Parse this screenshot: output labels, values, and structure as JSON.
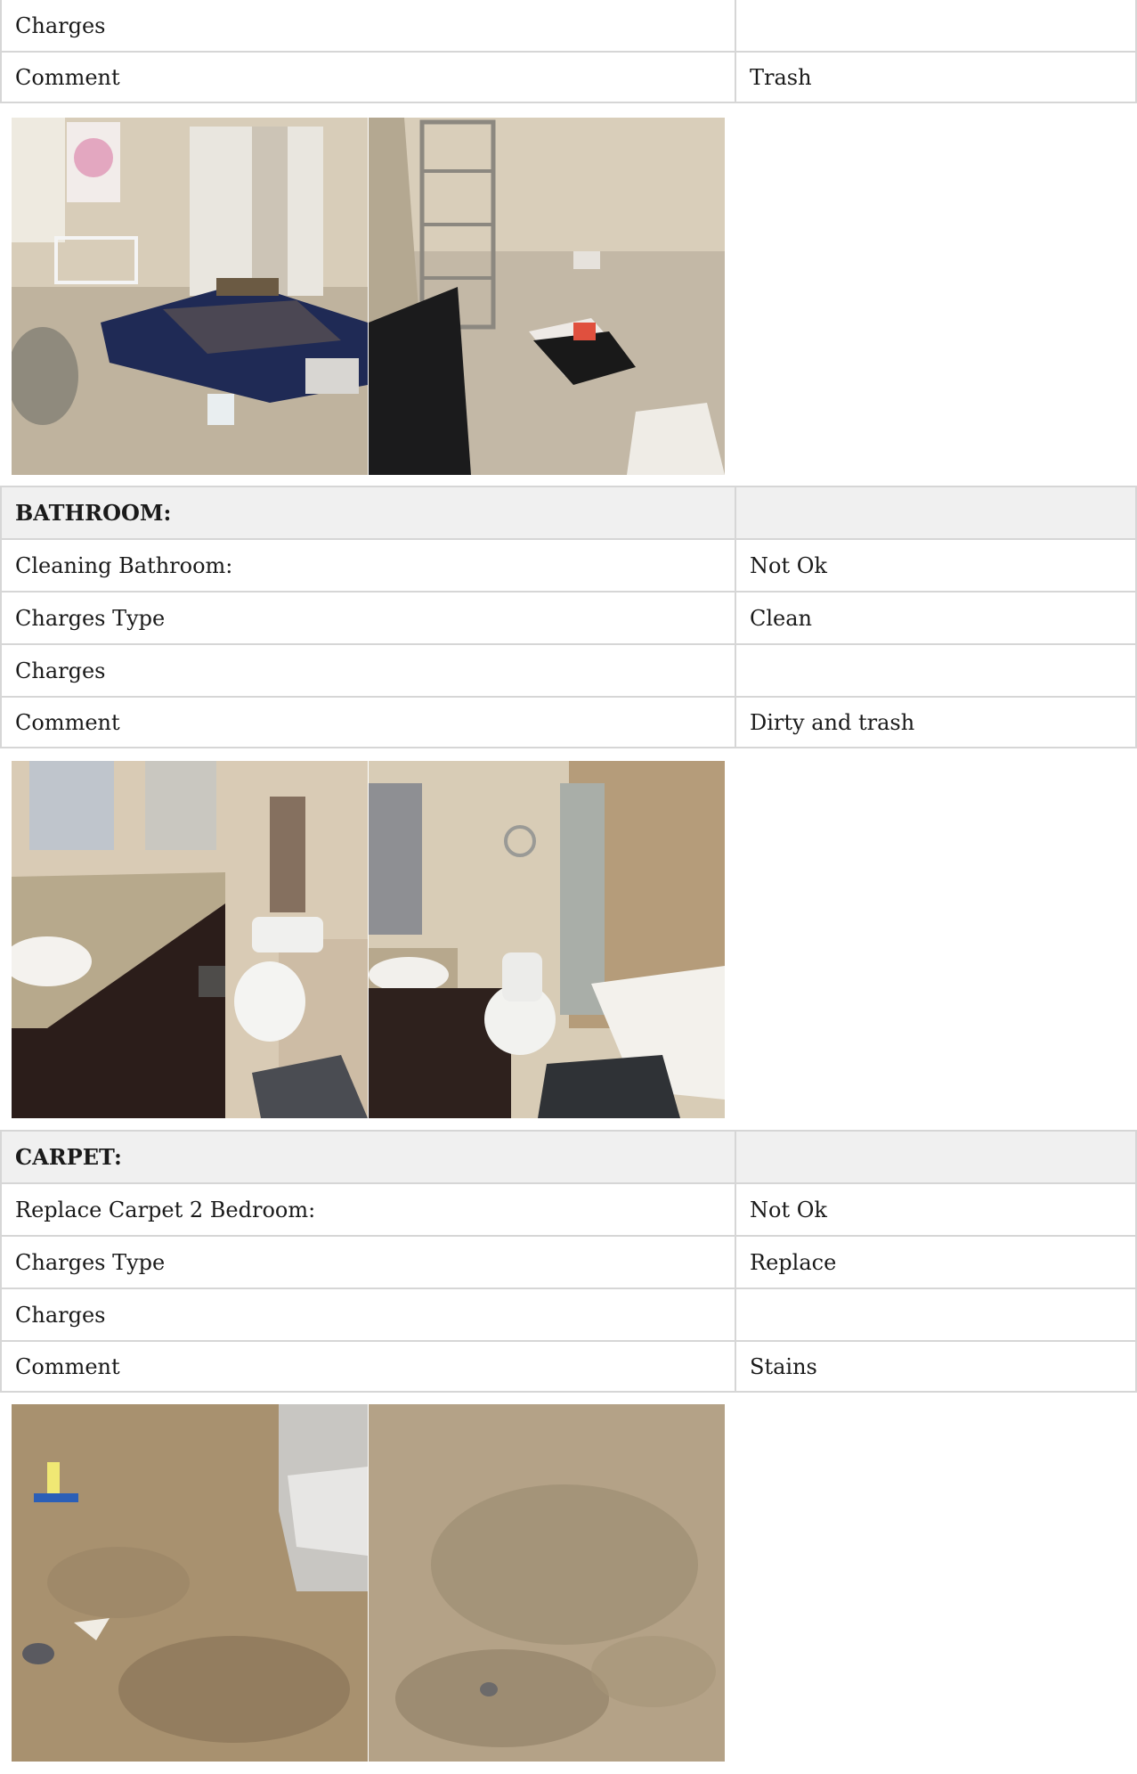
{
  "bedroom_tail": {
    "charges_label": "Charges",
    "charges_value": "",
    "comment_label": "Comment",
    "comment_value": "Trash",
    "photos": [
      "bedroom-photo-1",
      "bedroom-photo-2"
    ]
  },
  "bathroom": {
    "heading": "BATHROOM:",
    "rows": [
      {
        "label": "Cleaning Bathroom:",
        "value": "Not Ok"
      },
      {
        "label": "Charges Type",
        "value": "Clean"
      },
      {
        "label": "Charges",
        "value": ""
      },
      {
        "label": "Comment",
        "value": "Dirty and trash"
      }
    ],
    "photos": [
      "bathroom-photo-1",
      "bathroom-photo-2"
    ]
  },
  "carpet": {
    "heading": "CARPET:",
    "rows": [
      {
        "label": "Replace Carpet 2 Bedroom:",
        "value": "Not Ok"
      },
      {
        "label": "Charges Type",
        "value": "Replace"
      },
      {
        "label": "Charges",
        "value": ""
      },
      {
        "label": "Comment",
        "value": "Stains"
      }
    ],
    "photos": [
      "carpet-photo-1",
      "carpet-photo-2"
    ]
  },
  "colors": {
    "border": "#d6d6d6",
    "header_bg": "#f0f0f0",
    "text": "#1a1a1a"
  }
}
